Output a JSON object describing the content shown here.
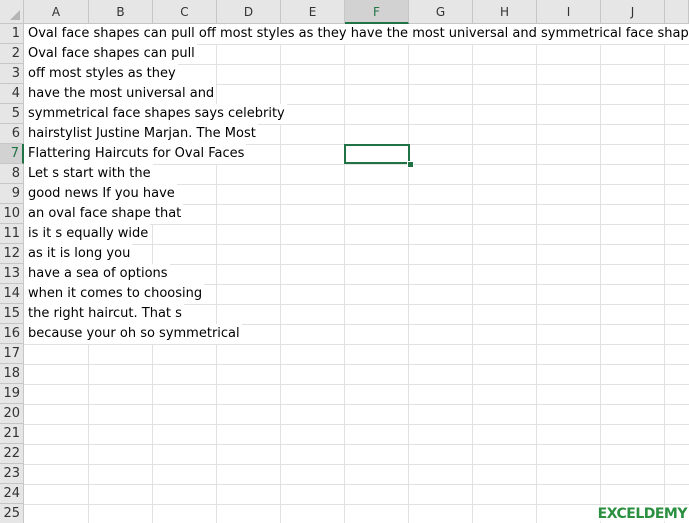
{
  "columns": [
    "A",
    "B",
    "C",
    "D",
    "E",
    "F",
    "G",
    "H",
    "I",
    "J"
  ],
  "rows": [
    "1",
    "2",
    "3",
    "4",
    "5",
    "6",
    "7",
    "8",
    "9",
    "10",
    "11",
    "12",
    "13",
    "14",
    "15",
    "16",
    "17",
    "18",
    "19",
    "20",
    "21",
    "22",
    "23",
    "24",
    "25"
  ],
  "active_cell": {
    "column": "F",
    "row": "7"
  },
  "cells": {
    "A1": "Oval face shapes can pull off most styles as they have the most universal and symmetrical face shapes says celebrity hairstylist Justine Marjan. The Most Flattering Haircuts for Oval Faces",
    "A2": "Oval face shapes can pull",
    "A3": "off most styles as they",
    "A4": "have the most universal and",
    "A5": "symmetrical face shapes says celebrity",
    "A6": "hairstylist Justine Marjan. The Most",
    "A7": "Flattering Haircuts for Oval Faces",
    "A8": "Let s start with the",
    "A9": "good news If you have",
    "A10": "an oval face shape that",
    "A11": "is it s equally wide",
    "A12": "as it is long you",
    "A13": "have a sea of options",
    "A14": "when it comes to choosing",
    "A15": "the right haircut. That s",
    "A16": "because your oh so symmetrical"
  },
  "watermark": "EXCELDEMY",
  "colors": {
    "accent": "#217346",
    "header_bg": "#e6e6e6",
    "gridline": "#e1e1e1"
  }
}
